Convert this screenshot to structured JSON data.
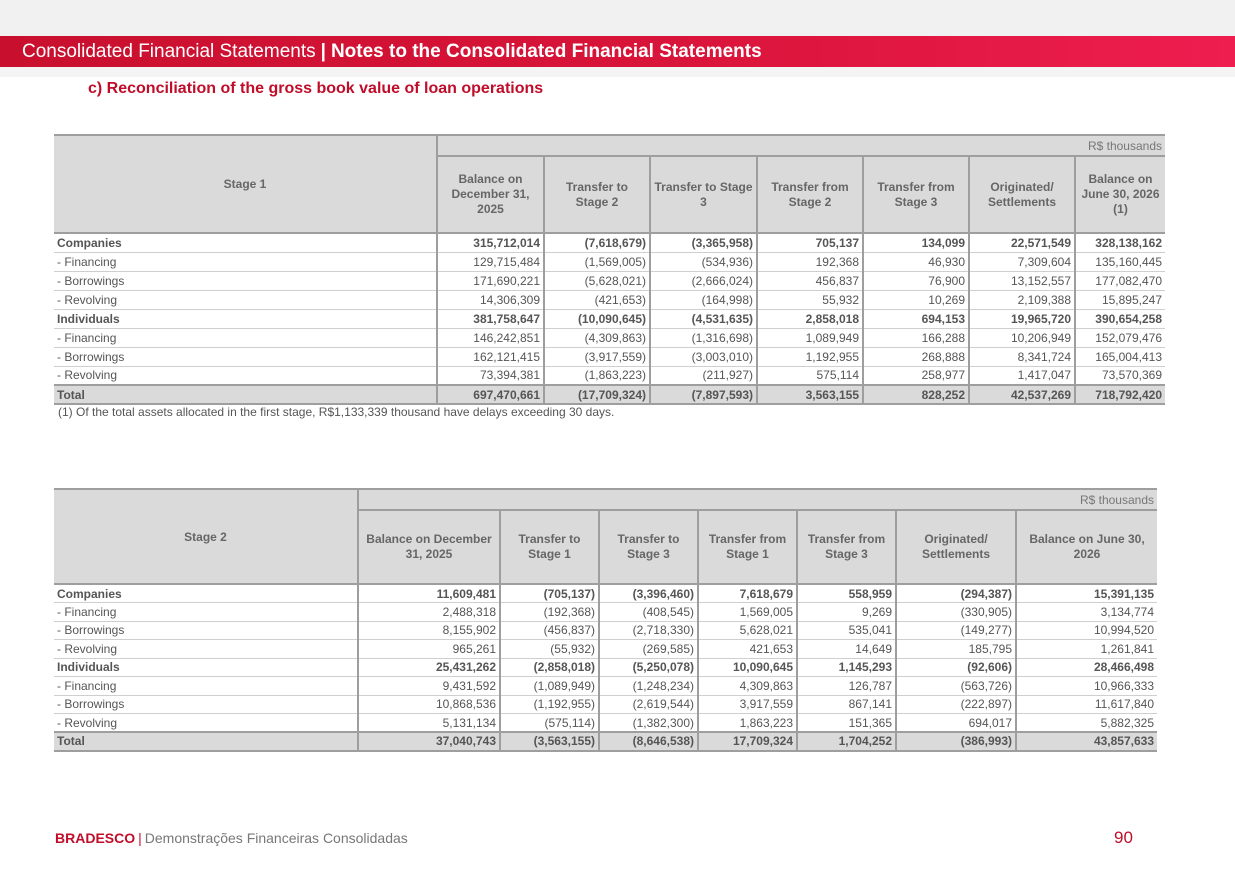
{
  "header": {
    "left": "Consolidated Financial Statements",
    "sep": "|",
    "right": "Notes to the Consolidated Financial Statements"
  },
  "section_title": "c) Reconciliation of the gross book value of loan operations",
  "table1": {
    "stage_label": "Stage 1",
    "unit": "R$ thousands",
    "columns": [
      "Balance on December 31, 2025",
      "Transfer to Stage 2",
      "Transfer to Stage 3",
      "Transfer from Stage 2",
      "Transfer from Stage 3",
      "Originated/ Settlements",
      "Balance on June 30, 2026 (1)"
    ],
    "rows": [
      {
        "label": "Companies",
        "bold": true,
        "values": [
          "315,712,014",
          "(7,618,679)",
          "(3,365,958)",
          "705,137",
          "134,099",
          "22,571,549",
          "328,138,162"
        ]
      },
      {
        "label": "- Financing",
        "bold": false,
        "values": [
          "129,715,484",
          "(1,569,005)",
          "(534,936)",
          "192,368",
          "46,930",
          "7,309,604",
          "135,160,445"
        ]
      },
      {
        "label": "- Borrowings",
        "bold": false,
        "values": [
          "171,690,221",
          "(5,628,021)",
          "(2,666,024)",
          "456,837",
          "76,900",
          "13,152,557",
          "177,082,470"
        ]
      },
      {
        "label": "- Revolving",
        "bold": false,
        "values": [
          "14,306,309",
          "(421,653)",
          "(164,998)",
          "55,932",
          "10,269",
          "2,109,388",
          "15,895,247"
        ]
      },
      {
        "label": "Individuals",
        "bold": true,
        "values": [
          "381,758,647",
          "(10,090,645)",
          "(4,531,635)",
          "2,858,018",
          "694,153",
          "19,965,720",
          "390,654,258"
        ]
      },
      {
        "label": "- Financing",
        "bold": false,
        "values": [
          "146,242,851",
          "(4,309,863)",
          "(1,316,698)",
          "1,089,949",
          "166,288",
          "10,206,949",
          "152,079,476"
        ]
      },
      {
        "label": "- Borrowings",
        "bold": false,
        "values": [
          "162,121,415",
          "(3,917,559)",
          "(3,003,010)",
          "1,192,955",
          "268,888",
          "8,341,724",
          "165,004,413"
        ]
      },
      {
        "label": "- Revolving",
        "bold": false,
        "values": [
          "73,394,381",
          "(1,863,223)",
          "(211,927)",
          "575,114",
          "258,977",
          "1,417,047",
          "73,570,369"
        ]
      }
    ],
    "total": {
      "label": "Total",
      "values": [
        "697,470,661",
        "(17,709,324)",
        "(7,897,593)",
        "3,563,155",
        "828,252",
        "42,537,269",
        "718,792,420"
      ]
    },
    "footnote": "(1) Of the total assets allocated in the first stage, R$1,133,339 thousand have delays exceeding 30 days."
  },
  "table2": {
    "stage_label": "Stage 2",
    "unit": "R$ thousands",
    "columns": [
      "Balance on December 31, 2025",
      "Transfer to Stage 1",
      "Transfer to Stage 3",
      "Transfer from Stage 1",
      "Transfer from Stage 3",
      "Originated/ Settlements",
      "Balance on June 30, 2026"
    ],
    "rows": [
      {
        "label": "Companies",
        "bold": true,
        "values": [
          "11,609,481",
          "(705,137)",
          "(3,396,460)",
          "7,618,679",
          "558,959",
          "(294,387)",
          "15,391,135"
        ]
      },
      {
        "label": "- Financing",
        "bold": false,
        "values": [
          "2,488,318",
          "(192,368)",
          "(408,545)",
          "1,569,005",
          "9,269",
          "(330,905)",
          "3,134,774"
        ]
      },
      {
        "label": "- Borrowings",
        "bold": false,
        "values": [
          "8,155,902",
          "(456,837)",
          "(2,718,330)",
          "5,628,021",
          "535,041",
          "(149,277)",
          "10,994,520"
        ]
      },
      {
        "label": "- Revolving",
        "bold": false,
        "values": [
          "965,261",
          "(55,932)",
          "(269,585)",
          "421,653",
          "14,649",
          "185,795",
          "1,261,841"
        ]
      },
      {
        "label": "Individuals",
        "bold": true,
        "values": [
          "25,431,262",
          "(2,858,018)",
          "(5,250,078)",
          "10,090,645",
          "1,145,293",
          "(92,606)",
          "28,466,498"
        ]
      },
      {
        "label": "- Financing",
        "bold": false,
        "values": [
          "9,431,592",
          "(1,089,949)",
          "(1,248,234)",
          "4,309,863",
          "126,787",
          "(563,726)",
          "10,966,333"
        ]
      },
      {
        "label": "- Borrowings",
        "bold": false,
        "values": [
          "10,868,536",
          "(1,192,955)",
          "(2,619,544)",
          "3,917,559",
          "867,141",
          "(222,897)",
          "11,617,840"
        ]
      },
      {
        "label": "- Revolving",
        "bold": false,
        "values": [
          "5,131,134",
          "(575,114)",
          "(1,382,300)",
          "1,863,223",
          "151,365",
          "694,017",
          "5,882,325"
        ]
      }
    ],
    "total": {
      "label": "Total",
      "values": [
        "37,040,743",
        "(3,563,155)",
        "(8,646,538)",
        "17,709,324",
        "1,704,252",
        "(386,993)",
        "43,857,633"
      ]
    }
  },
  "footer": {
    "brand": "BRADESCO",
    "sep": "|",
    "text": "Demonstrações Financeiras Consolidadas",
    "page_number": "90"
  },
  "colors": {
    "brand_red": "#c00d2a",
    "header_gradient_start": "#c8102e",
    "header_gradient_end": "#ee1e4f",
    "table_header_gray": "#dadada",
    "table_border_gray": "#9e9e9e"
  }
}
